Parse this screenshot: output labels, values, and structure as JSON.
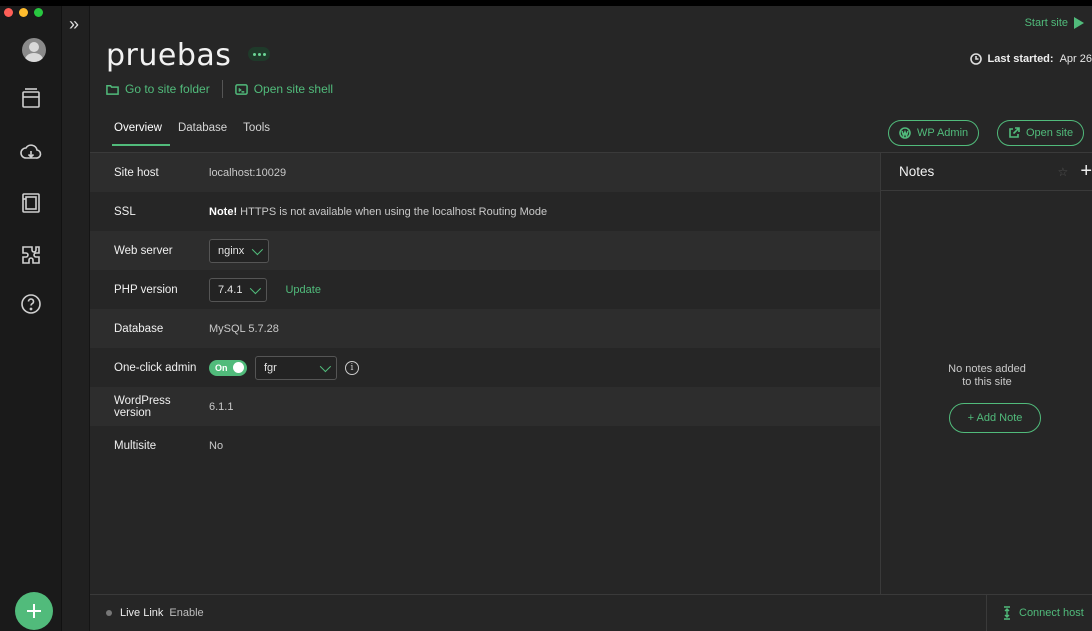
{
  "colors": {
    "accent": "#51bb7b",
    "background": "#262626",
    "rail": "#1a1a1a"
  },
  "window": {
    "traffic_lights": [
      "#ff5f57",
      "#febc2e",
      "#28c840"
    ]
  },
  "sidebar": {
    "icons": [
      "avatar",
      "sites-icon",
      "cloud-icon",
      "blueprints-icon",
      "addons-icon",
      "help-icon"
    ],
    "collapse_glyph": "»"
  },
  "header": {
    "site_name": "pruebas",
    "go_to_folder": "Go to site folder",
    "open_shell": "Open site shell",
    "start_site": "Start site",
    "last_started_label": "Last started:",
    "last_started_value": "Apr 26"
  },
  "tabs": [
    "Overview",
    "Database",
    "Tools"
  ],
  "actions": {
    "wp_admin": "WP Admin",
    "open_site": "Open site"
  },
  "details": {
    "site_host": {
      "label": "Site host",
      "value": "localhost:10029"
    },
    "ssl": {
      "label": "SSL",
      "note_bold": "Note!",
      "note_text": " HTTPS is not available when using the localhost Routing Mode"
    },
    "web_server": {
      "label": "Web server",
      "value": "nginx"
    },
    "php_version": {
      "label": "PHP version",
      "value": "7.4.1",
      "update": "Update"
    },
    "database": {
      "label": "Database",
      "value": "MySQL 5.7.28"
    },
    "one_click_admin": {
      "label": "One-click admin",
      "toggle": "On",
      "user": "fgr"
    },
    "wordpress_version": {
      "label": "WordPress version",
      "value": "6.1.1"
    },
    "multisite": {
      "label": "Multisite",
      "value": "No"
    }
  },
  "notes": {
    "title": "Notes",
    "empty_line1": "No notes added",
    "empty_line2": "to this site",
    "add_note": "+ Add Note"
  },
  "footer": {
    "live_link": "Live Link",
    "enable": "Enable",
    "connect_host": "Connect host"
  }
}
